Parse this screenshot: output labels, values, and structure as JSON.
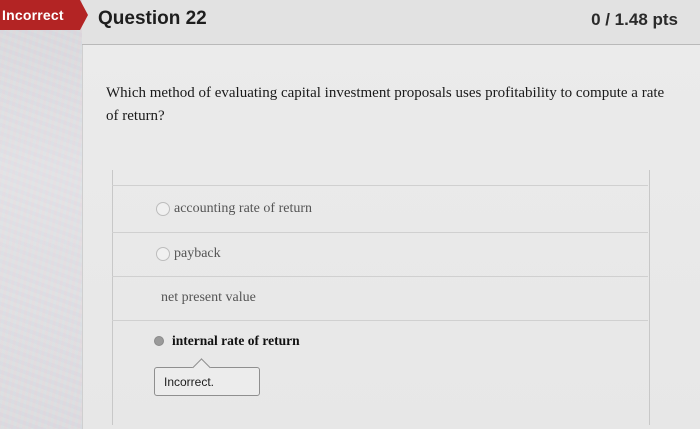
{
  "status": {
    "label": "Incorrect",
    "color": "#b32424"
  },
  "question": {
    "title": "Question 22",
    "points": "0 / 1.48 pts",
    "text": "Which method of evaluating capital investment proposals uses profitability to compute a rate of return?"
  },
  "answers": [
    {
      "label": "accounting rate of return",
      "selected": false
    },
    {
      "label": "payback",
      "selected": false
    },
    {
      "label": "net present value",
      "selected": false
    },
    {
      "label": "internal rate of return",
      "selected": true
    }
  ],
  "feedback": {
    "label": "Incorrect."
  }
}
